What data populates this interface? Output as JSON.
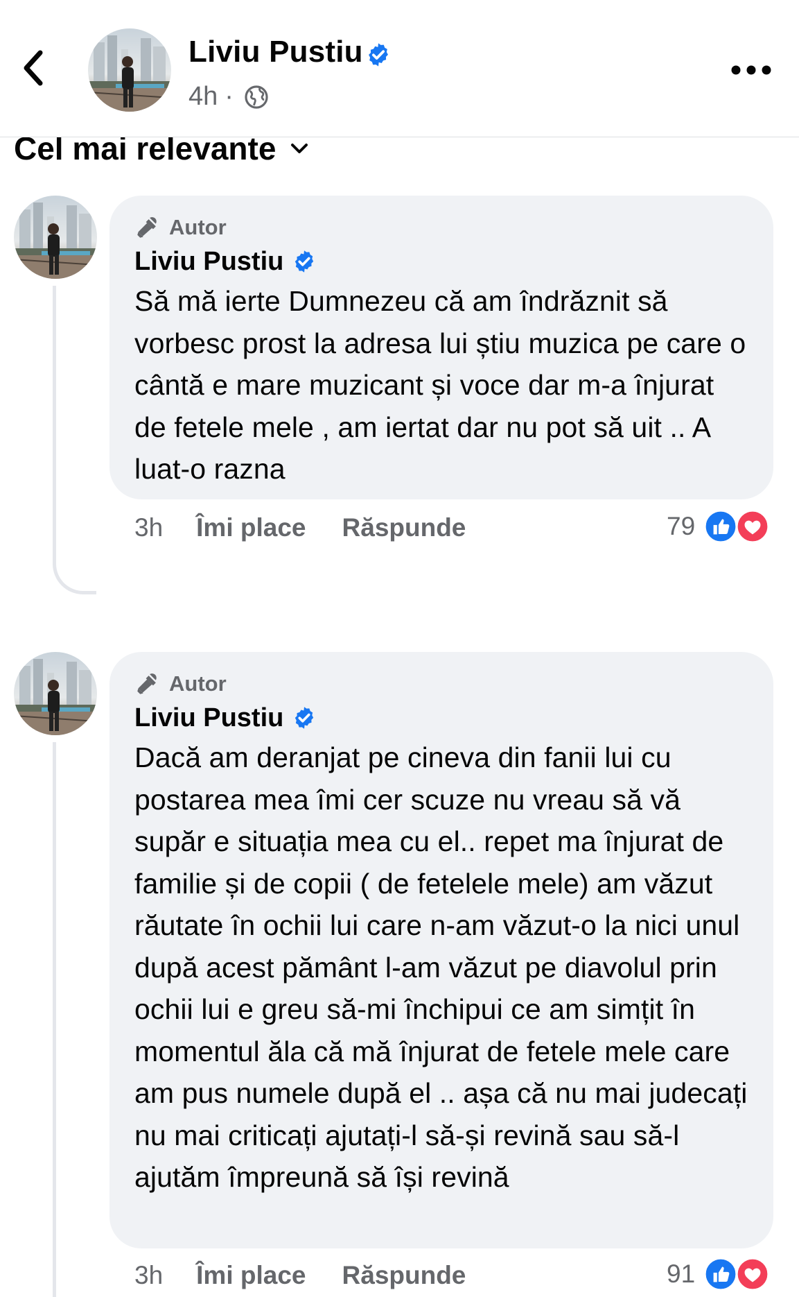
{
  "header": {
    "name": "Liviu Pustiu",
    "time": "4h",
    "separator": "·"
  },
  "sort": {
    "label": "Cel mai relevante"
  },
  "comments": [
    {
      "badge": "Autor",
      "author": "Liviu Pustiu",
      "text": "Să mă ierte Dumnezeu că am îndrăznit să vorbesc prost la adresa lui știu muzica pe care o cântă e mare muzicant și voce dar m-a înjurat de fetele mele , am iertat dar nu pot să uit .. A luat-o razna",
      "time": "3h",
      "like_label": "Îmi place",
      "reply_label": "Răspunde",
      "reaction_count": "79"
    },
    {
      "badge": "Autor",
      "author": "Liviu Pustiu",
      "text": "Dacă am deranjat pe cineva din fanii lui cu postarea mea îmi cer scuze nu vreau să vă supăr e situația mea cu el.. repet ma înjurat de familie și de copii ( de fetelele mele) am văzut răutate în ochii lui care n-am văzut-o la nici unul după acest pământ l-am văzut pe diavolul prin ochii lui e greu să-mi închipui ce am simțit în momentul ăla că mă înjurat de fetele mele care am pus numele după el .. așa că nu mai judecați nu mai criticați ajutați-l  să-și revină sau să-l ajutăm împreună să își revină",
      "time": "3h",
      "like_label": "Îmi place",
      "reply_label": "Răspunde",
      "reaction_count": "91"
    }
  ],
  "colors": {
    "verified": "#1877f2",
    "like_reaction": "#1877f2",
    "love_reaction": "#f33e58",
    "secondary_text": "#65676b",
    "bubble": "#f0f2f5"
  },
  "icons": [
    "back-arrow-icon",
    "verified-badge-icon",
    "globe-icon",
    "more-options-icon",
    "chevron-down-icon",
    "microphone-icon",
    "like-reaction-icon",
    "love-reaction-icon"
  ]
}
